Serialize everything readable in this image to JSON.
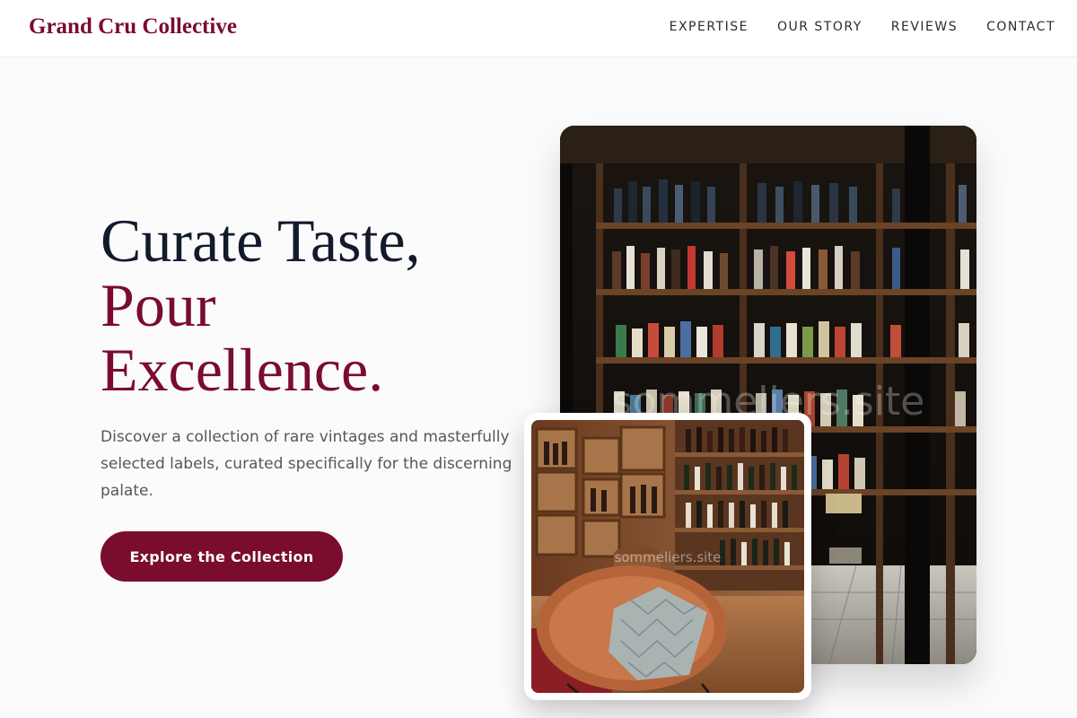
{
  "header": {
    "brand": "Grand Cru Collective",
    "nav": [
      "EXPERTISE",
      "OUR STORY",
      "REVIEWS",
      "CONTACT"
    ]
  },
  "hero": {
    "title_line1": "Curate Taste,",
    "title_line2": "Pour",
    "title_line3": "Excellence.",
    "description": "Discover a collection of rare vintages and masterfully selected labels, curated specifically for the discerning palate.",
    "cta_label": "Explore the Collection"
  },
  "images": {
    "watermark": "sommeliers.site",
    "main_alt": "wine-shop-shelves-photo",
    "small_alt": "wine-lounge-chair-photo"
  },
  "colors": {
    "brand": "#7a0c2e",
    "heading": "#131a2c",
    "body_text": "#55575c",
    "background": "#fbfbfb"
  }
}
